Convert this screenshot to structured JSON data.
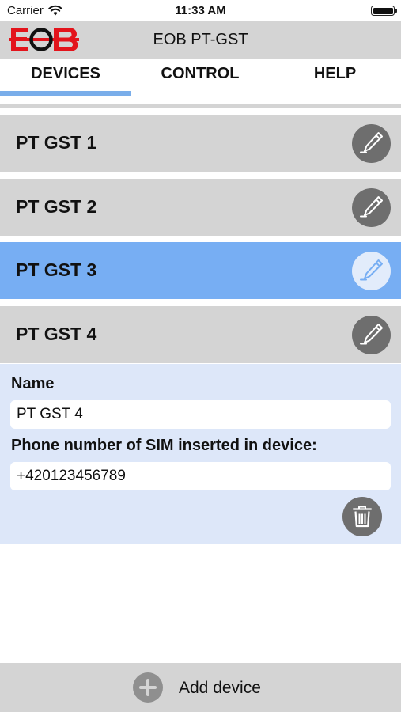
{
  "status_bar": {
    "carrier": "Carrier",
    "time": "11:33 AM"
  },
  "header": {
    "logo_text": "EOB",
    "title": "EOB PT-GST",
    "logo_color": "#e3141c"
  },
  "tabs": [
    {
      "label": "DEVICES",
      "active": true
    },
    {
      "label": "CONTROL",
      "active": false
    },
    {
      "label": "HELP",
      "active": false
    }
  ],
  "devices": [
    {
      "name": "PT GST 1",
      "selected": false,
      "edit_icon": "pencil-icon"
    },
    {
      "name": "PT GST 2",
      "selected": false,
      "edit_icon": "pencil-icon"
    },
    {
      "name": "PT GST 3",
      "selected": true,
      "edit_icon": "pencil-icon"
    },
    {
      "name": "PT GST 4",
      "selected": false,
      "edit_icon": "pencil-icon"
    }
  ],
  "edit_panel": {
    "name_label": "Name",
    "name_value": "PT GST 4",
    "phone_label": "Phone number of SIM inserted in device:",
    "phone_value": "+420123456789",
    "delete_icon": "trash-icon"
  },
  "bottom_bar": {
    "add_label": "Add device",
    "add_icon": "plus-circle-icon"
  },
  "colors": {
    "accent": "#77aef3",
    "header_bg": "#d4d4d4",
    "panel_bg": "#dde7f9",
    "icon_button_bg": "#6e6e6e"
  }
}
